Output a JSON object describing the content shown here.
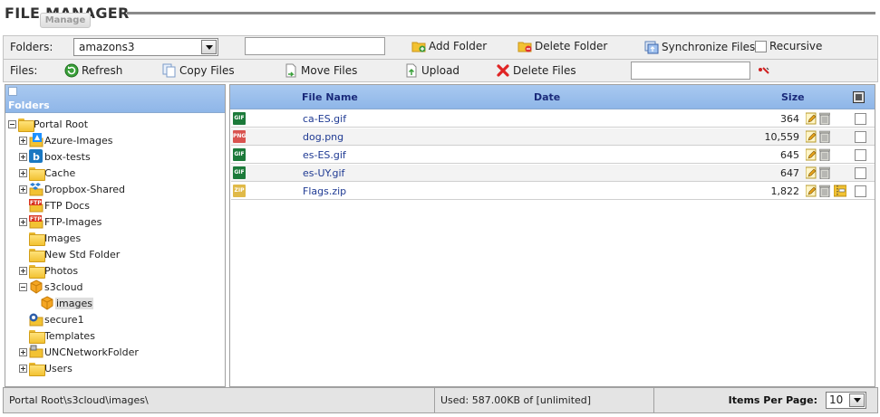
{
  "header": {
    "title": "FILE MANAGER",
    "manage_label": "Manage"
  },
  "toolbar_folders": {
    "label": "Folders:",
    "selected_folder": "amazons3",
    "folder_input_value": "",
    "add_folder": "Add Folder",
    "delete_folder": "Delete Folder",
    "synchronize_files": "Synchronize Files",
    "recursive": "Recursive"
  },
  "toolbar_files": {
    "label": "Files:",
    "refresh": "Refresh",
    "copy_files": "Copy Files",
    "move_files": "Move Files",
    "upload": "Upload",
    "delete_files": "Delete Files",
    "filter_value": ""
  },
  "tree": {
    "header": "Folders",
    "items": [
      {
        "label": "Portal Root",
        "depth": 0,
        "expander": "minus",
        "icon": "folder-icon"
      },
      {
        "label": "Azure-Images",
        "depth": 1,
        "expander": "plus",
        "icon": "azure-icon"
      },
      {
        "label": "box-tests",
        "depth": 1,
        "expander": "plus",
        "icon": "box-icon"
      },
      {
        "label": "Cache",
        "depth": 1,
        "expander": "plus",
        "icon": "folder-icon"
      },
      {
        "label": "Dropbox-Shared",
        "depth": 1,
        "expander": "plus",
        "icon": "dropbox-icon"
      },
      {
        "label": "FTP Docs",
        "depth": 1,
        "expander": "none",
        "icon": "ftp-icon"
      },
      {
        "label": "FTP-Images",
        "depth": 1,
        "expander": "plus",
        "icon": "ftp-icon"
      },
      {
        "label": "Images",
        "depth": 1,
        "expander": "none",
        "icon": "folder-icon"
      },
      {
        "label": "New Std Folder",
        "depth": 1,
        "expander": "none",
        "icon": "folder-icon"
      },
      {
        "label": "Photos",
        "depth": 1,
        "expander": "plus",
        "icon": "folder-icon"
      },
      {
        "label": "s3cloud",
        "depth": 1,
        "expander": "minus",
        "icon": "s3-icon"
      },
      {
        "label": "images",
        "depth": 2,
        "expander": "none",
        "icon": "s3-icon",
        "selected": true
      },
      {
        "label": "secure1",
        "depth": 1,
        "expander": "none",
        "icon": "secure-folder-icon"
      },
      {
        "label": "Templates",
        "depth": 1,
        "expander": "none",
        "icon": "folder-icon"
      },
      {
        "label": "UNCNetworkFolder",
        "depth": 1,
        "expander": "plus",
        "icon": "network-folder-icon"
      },
      {
        "label": "Users",
        "depth": 1,
        "expander": "plus",
        "icon": "folder-icon"
      }
    ]
  },
  "grid": {
    "columns": {
      "file_name": "File Name",
      "date": "Date",
      "size": "Size"
    },
    "rows": [
      {
        "name": "ca-ES.gif",
        "size": "364",
        "type": "GIF",
        "color": "#1c7a3a",
        "zip": false
      },
      {
        "name": "dog.png",
        "size": "10,559",
        "type": "PNG",
        "color": "#d9534f",
        "zip": false
      },
      {
        "name": "es-ES.gif",
        "size": "645",
        "type": "GIF",
        "color": "#1c7a3a",
        "zip": false
      },
      {
        "name": "es-UY.gif",
        "size": "647",
        "type": "GIF",
        "color": "#1c7a3a",
        "zip": false
      },
      {
        "name": "Flags.zip",
        "size": "1,822",
        "type": "ZIP",
        "color": "#e0b948",
        "zip": true
      }
    ]
  },
  "status": {
    "path": "Portal Root\\s3cloud\\images\\",
    "usage": "Used: 587.00KB of [unlimited]",
    "items_per_page_label": "Items Per Page:",
    "items_per_page_value": "10"
  },
  "colors": {
    "header_blue": "#9fc0ee",
    "link_blue": "#1f3a93",
    "toolbar_bg": "#efefef"
  }
}
